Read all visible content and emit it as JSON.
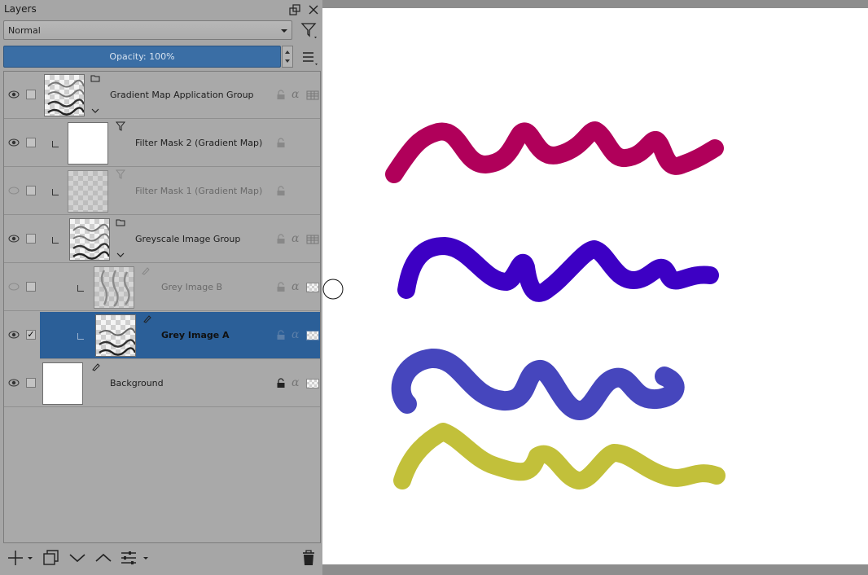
{
  "docker": {
    "title": "Layers",
    "blend_mode": "Normal",
    "opacity_label": "Opacity:  100%"
  },
  "layers": [
    {
      "name": "Gradient Map Application Group",
      "visible": true,
      "checked": false,
      "type": "group"
    },
    {
      "name": "Filter Mask 2 (Gradient Map)",
      "visible": true,
      "checked": false,
      "type": "filter-mask"
    },
    {
      "name": "Filter Mask 1 (Gradient Map)",
      "visible": false,
      "checked": false,
      "type": "filter-mask"
    },
    {
      "name": "Greyscale Image Group",
      "visible": true,
      "checked": false,
      "type": "group"
    },
    {
      "name": "Grey Image B",
      "visible": false,
      "checked": false,
      "type": "paint"
    },
    {
      "name": "Grey Image A",
      "visible": true,
      "checked": true,
      "type": "paint",
      "selected": true
    },
    {
      "name": "Background",
      "visible": true,
      "checked": false,
      "type": "paint",
      "locked": true
    }
  ],
  "colors": {
    "selection": "#2b5f98",
    "stroke1": "#b0005a",
    "stroke2": "#3d00c4",
    "stroke3": "#4646bd",
    "stroke4": "#c2c03a"
  },
  "icons": [
    "float-icon",
    "close-icon",
    "filter-icon",
    "menu-icon",
    "add-icon",
    "duplicate-icon",
    "move-down-icon",
    "move-up-icon",
    "properties-icon",
    "delete-icon",
    "eye-icon",
    "lock-icon",
    "alpha-icon",
    "group-icon"
  ]
}
